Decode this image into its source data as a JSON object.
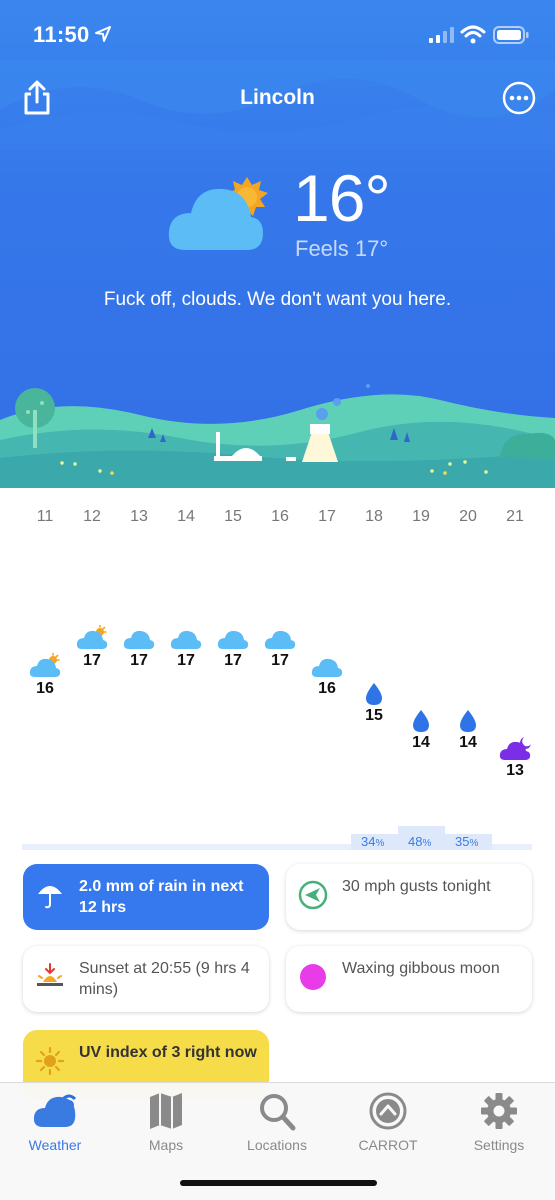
{
  "status_bar": {
    "time": "11:50"
  },
  "header": {
    "city": "Lincoln"
  },
  "current": {
    "temperature": "16°",
    "feels_like": "Feels 17°",
    "quip": "Fuck off, clouds. We don't want you here."
  },
  "hourly": {
    "hours": [
      "11",
      "12",
      "13",
      "14",
      "15",
      "16",
      "17",
      "18",
      "19",
      "20",
      "21"
    ],
    "temps": [
      "16",
      "17",
      "17",
      "17",
      "17",
      "17",
      "16",
      "15",
      "14",
      "14",
      "13"
    ],
    "icons": [
      "cloud-sun-icon",
      "cloud-sun-icon",
      "cloud-icon",
      "cloud-icon",
      "cloud-icon",
      "cloud-icon",
      "cloud-icon",
      "raindrop-icon",
      "raindrop-icon",
      "raindrop-icon",
      "cloud-moon-icon"
    ]
  },
  "precipitation": {
    "labels": [
      {
        "value": "34",
        "unit": "%"
      },
      {
        "value": "48",
        "unit": "%"
      },
      {
        "value": "35",
        "unit": "%"
      }
    ]
  },
  "cards": {
    "rain": "2.0 mm of rain in next 12 hrs",
    "wind": "30 mph gusts tonight",
    "sunset": "Sunset at 20:55 (9 hrs 4 mins)",
    "moon": "Waxing gibbous moon",
    "uv": "UV index of 3 right now"
  },
  "tabs": {
    "weather": "Weather",
    "maps": "Maps",
    "locations": "Locations",
    "carrot": "CARROT",
    "settings": "Settings"
  },
  "colors": {
    "sky": "#3577ea",
    "accent": "#3a7be2",
    "uv_card": "#f7dc4a",
    "moon": "#e83ce8",
    "cloud_icon": "#5bbcf6",
    "rain_icon": "#2f74e6",
    "night_icon": "#7a2ee6"
  }
}
